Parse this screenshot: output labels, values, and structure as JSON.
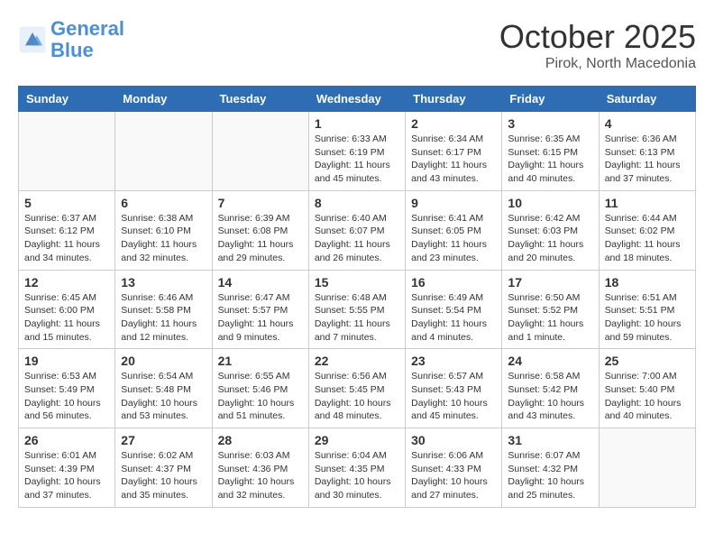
{
  "header": {
    "logo_line1": "General",
    "logo_line2": "Blue",
    "month": "October 2025",
    "location": "Pirok, North Macedonia"
  },
  "weekdays": [
    "Sunday",
    "Monday",
    "Tuesday",
    "Wednesday",
    "Thursday",
    "Friday",
    "Saturday"
  ],
  "weeks": [
    [
      {
        "day": "",
        "info": ""
      },
      {
        "day": "",
        "info": ""
      },
      {
        "day": "",
        "info": ""
      },
      {
        "day": "1",
        "info": "Sunrise: 6:33 AM\nSunset: 6:19 PM\nDaylight: 11 hours and 45 minutes."
      },
      {
        "day": "2",
        "info": "Sunrise: 6:34 AM\nSunset: 6:17 PM\nDaylight: 11 hours and 43 minutes."
      },
      {
        "day": "3",
        "info": "Sunrise: 6:35 AM\nSunset: 6:15 PM\nDaylight: 11 hours and 40 minutes."
      },
      {
        "day": "4",
        "info": "Sunrise: 6:36 AM\nSunset: 6:13 PM\nDaylight: 11 hours and 37 minutes."
      }
    ],
    [
      {
        "day": "5",
        "info": "Sunrise: 6:37 AM\nSunset: 6:12 PM\nDaylight: 11 hours and 34 minutes."
      },
      {
        "day": "6",
        "info": "Sunrise: 6:38 AM\nSunset: 6:10 PM\nDaylight: 11 hours and 32 minutes."
      },
      {
        "day": "7",
        "info": "Sunrise: 6:39 AM\nSunset: 6:08 PM\nDaylight: 11 hours and 29 minutes."
      },
      {
        "day": "8",
        "info": "Sunrise: 6:40 AM\nSunset: 6:07 PM\nDaylight: 11 hours and 26 minutes."
      },
      {
        "day": "9",
        "info": "Sunrise: 6:41 AM\nSunset: 6:05 PM\nDaylight: 11 hours and 23 minutes."
      },
      {
        "day": "10",
        "info": "Sunrise: 6:42 AM\nSunset: 6:03 PM\nDaylight: 11 hours and 20 minutes."
      },
      {
        "day": "11",
        "info": "Sunrise: 6:44 AM\nSunset: 6:02 PM\nDaylight: 11 hours and 18 minutes."
      }
    ],
    [
      {
        "day": "12",
        "info": "Sunrise: 6:45 AM\nSunset: 6:00 PM\nDaylight: 11 hours and 15 minutes."
      },
      {
        "day": "13",
        "info": "Sunrise: 6:46 AM\nSunset: 5:58 PM\nDaylight: 11 hours and 12 minutes."
      },
      {
        "day": "14",
        "info": "Sunrise: 6:47 AM\nSunset: 5:57 PM\nDaylight: 11 hours and 9 minutes."
      },
      {
        "day": "15",
        "info": "Sunrise: 6:48 AM\nSunset: 5:55 PM\nDaylight: 11 hours and 7 minutes."
      },
      {
        "day": "16",
        "info": "Sunrise: 6:49 AM\nSunset: 5:54 PM\nDaylight: 11 hours and 4 minutes."
      },
      {
        "day": "17",
        "info": "Sunrise: 6:50 AM\nSunset: 5:52 PM\nDaylight: 11 hours and 1 minute."
      },
      {
        "day": "18",
        "info": "Sunrise: 6:51 AM\nSunset: 5:51 PM\nDaylight: 10 hours and 59 minutes."
      }
    ],
    [
      {
        "day": "19",
        "info": "Sunrise: 6:53 AM\nSunset: 5:49 PM\nDaylight: 10 hours and 56 minutes."
      },
      {
        "day": "20",
        "info": "Sunrise: 6:54 AM\nSunset: 5:48 PM\nDaylight: 10 hours and 53 minutes."
      },
      {
        "day": "21",
        "info": "Sunrise: 6:55 AM\nSunset: 5:46 PM\nDaylight: 10 hours and 51 minutes."
      },
      {
        "day": "22",
        "info": "Sunrise: 6:56 AM\nSunset: 5:45 PM\nDaylight: 10 hours and 48 minutes."
      },
      {
        "day": "23",
        "info": "Sunrise: 6:57 AM\nSunset: 5:43 PM\nDaylight: 10 hours and 45 minutes."
      },
      {
        "day": "24",
        "info": "Sunrise: 6:58 AM\nSunset: 5:42 PM\nDaylight: 10 hours and 43 minutes."
      },
      {
        "day": "25",
        "info": "Sunrise: 7:00 AM\nSunset: 5:40 PM\nDaylight: 10 hours and 40 minutes."
      }
    ],
    [
      {
        "day": "26",
        "info": "Sunrise: 6:01 AM\nSunset: 4:39 PM\nDaylight: 10 hours and 37 minutes."
      },
      {
        "day": "27",
        "info": "Sunrise: 6:02 AM\nSunset: 4:37 PM\nDaylight: 10 hours and 35 minutes."
      },
      {
        "day": "28",
        "info": "Sunrise: 6:03 AM\nSunset: 4:36 PM\nDaylight: 10 hours and 32 minutes."
      },
      {
        "day": "29",
        "info": "Sunrise: 6:04 AM\nSunset: 4:35 PM\nDaylight: 10 hours and 30 minutes."
      },
      {
        "day": "30",
        "info": "Sunrise: 6:06 AM\nSunset: 4:33 PM\nDaylight: 10 hours and 27 minutes."
      },
      {
        "day": "31",
        "info": "Sunrise: 6:07 AM\nSunset: 4:32 PM\nDaylight: 10 hours and 25 minutes."
      },
      {
        "day": "",
        "info": ""
      }
    ]
  ]
}
